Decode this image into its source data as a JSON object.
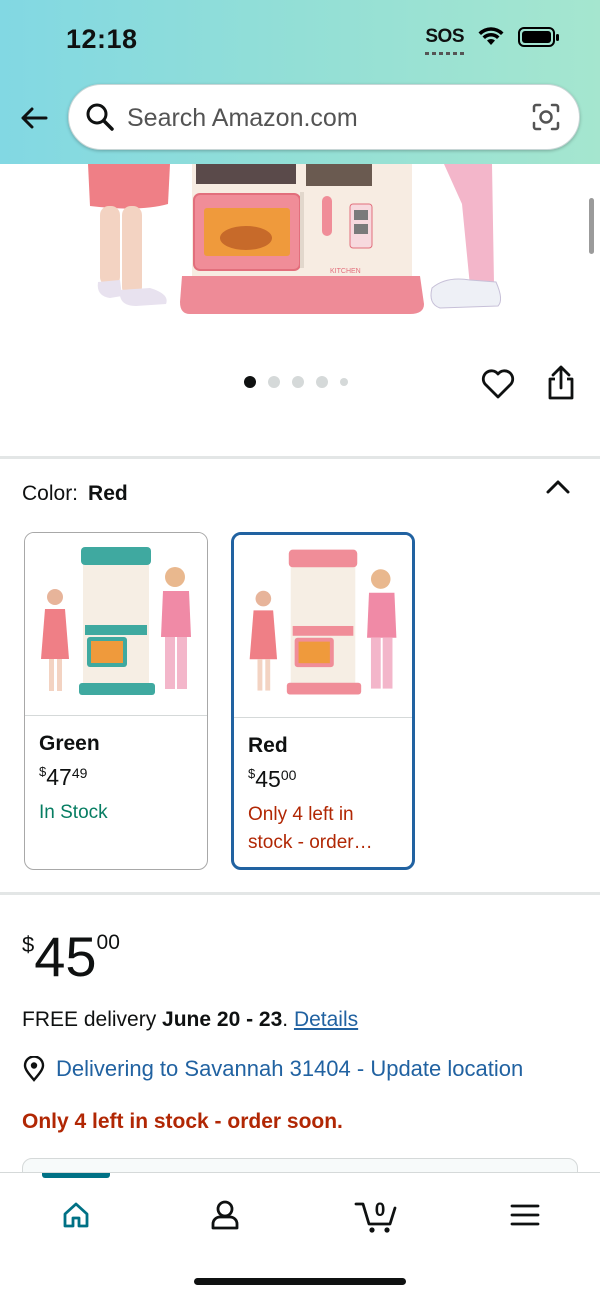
{
  "status_bar": {
    "time": "12:18",
    "sos": "SOS"
  },
  "search": {
    "placeholder": "Search Amazon.com"
  },
  "gallery": {
    "dot_count": 5,
    "active_index": 0,
    "badge_text": "KITCHEN"
  },
  "color_selector": {
    "label": "Color:",
    "selected": "Red",
    "options": [
      {
        "name": "Green",
        "price_symbol": "$",
        "price_whole": "47",
        "price_fraction": "49",
        "stock": "In Stock",
        "stock_color": "#067d62"
      },
      {
        "name": "Red",
        "price_symbol": "$",
        "price_whole": "45",
        "price_fraction": "00",
        "stock_line1": "Only 4 left in",
        "stock_line2": "stock - order…",
        "stock_color": "#b12704"
      }
    ]
  },
  "price": {
    "symbol": "$",
    "whole": "45",
    "fraction": "00"
  },
  "delivery": {
    "prefix": "FREE delivery ",
    "dates": "June 20 - 23",
    "suffix": ". ",
    "details_link": "Details"
  },
  "location": {
    "text": "Delivering to Savannah 31404 - Update location"
  },
  "stock_warning": "Only 4 left in stock - order soon.",
  "bottom_nav": {
    "items": [
      "home-icon",
      "account-icon",
      "cart-icon",
      "menu-icon"
    ],
    "cart_count": "0",
    "active": "home"
  },
  "colors": {
    "accent_link": "#2162a1",
    "teal": "#007185",
    "deal_red": "#b12704",
    "in_stock_green": "#067d62"
  }
}
